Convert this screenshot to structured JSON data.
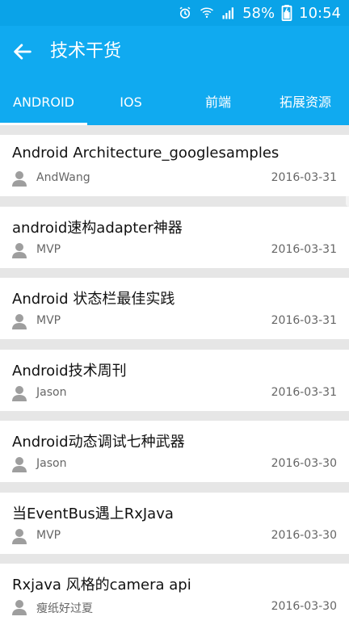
{
  "status": {
    "battery": "58%",
    "time": "10:54"
  },
  "appbar": {
    "title": "技术干货"
  },
  "tabs": [
    {
      "label": "ANDROID"
    },
    {
      "label": "IOS"
    },
    {
      "label": "前端"
    },
    {
      "label": "拓展资源"
    }
  ],
  "articles": [
    {
      "title": "Android Architecture_googlesamples",
      "author": "AndWang",
      "date": "2016-03-31"
    },
    {
      "title": "android速构adapter神器",
      "author": "MVP",
      "date": "2016-03-31"
    },
    {
      "title": "Android 状态栏最佳实践",
      "author": "MVP",
      "date": "2016-03-31"
    },
    {
      "title": "Android技术周刊",
      "author": "Jason",
      "date": "2016-03-31"
    },
    {
      "title": "Android动态调试七种武器",
      "author": "Jason",
      "date": "2016-03-30"
    },
    {
      "title": "当EventBus遇上RxJava",
      "author": "MVP",
      "date": "2016-03-30"
    },
    {
      "title": "Rxjava 风格的camera api",
      "author": "瘦纸好过夏",
      "date": "2016-03-30"
    }
  ]
}
